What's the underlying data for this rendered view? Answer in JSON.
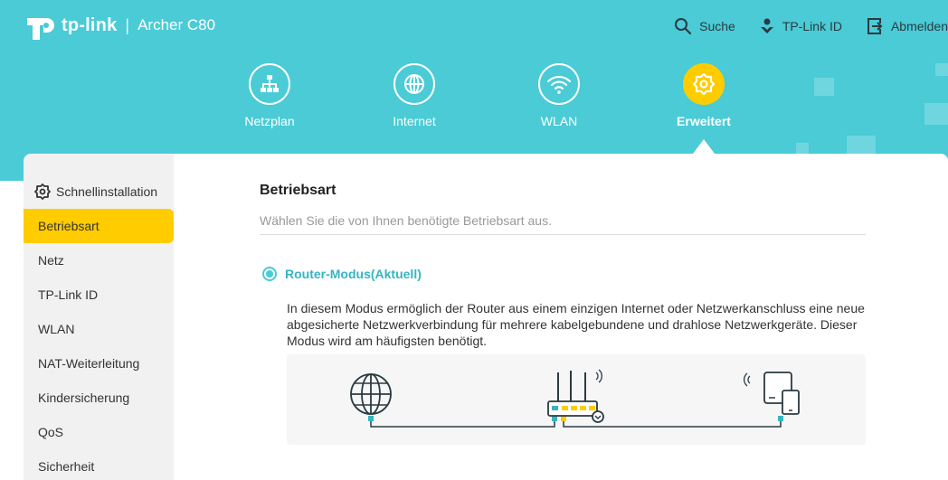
{
  "header": {
    "brand": "tp-link",
    "model": "Archer C80",
    "actions": [
      {
        "label": "Suche",
        "icon": "search-icon"
      },
      {
        "label": "TP-Link ID",
        "icon": "tplink-id-icon"
      },
      {
        "label": "Abmelden",
        "icon": "logout-icon"
      }
    ]
  },
  "nav": {
    "tabs": [
      {
        "label": "Netzplan",
        "icon": "network-map-icon",
        "active": false
      },
      {
        "label": "Internet",
        "icon": "globe-icon",
        "active": false
      },
      {
        "label": "WLAN",
        "icon": "wifi-icon",
        "active": false
      },
      {
        "label": "Erweitert",
        "icon": "gear-icon",
        "active": true
      }
    ]
  },
  "sidebar": {
    "items": [
      {
        "label": "Schnellinstallation",
        "icon": "gear-icon"
      },
      {
        "label": "Betriebsart",
        "active": true
      },
      {
        "label": "Netz"
      },
      {
        "label": "TP-Link ID"
      },
      {
        "label": "WLAN"
      },
      {
        "label": "NAT-Weiterleitung"
      },
      {
        "label": "Kindersicherung"
      },
      {
        "label": "QoS"
      },
      {
        "label": "Sicherheit"
      }
    ]
  },
  "main": {
    "title": "Betriebsart",
    "subtitle": "Wählen Sie die von Ihnen benötigte Betriebsart aus.",
    "mode_label": "Router-Modus(Aktuell)",
    "mode_selected": true,
    "mode_description": "In diesem Modus ermöglich der Router aus einem einzigen Internet oder Netzwerkanschluss eine neue abgesicherte Netzwerkverbindung für mehrere kabelgebundene und drahlose Netzwerkgeräte. Dieser Modus wird am häufigsten benötigt."
  },
  "colors": {
    "header_bg": "#4acbd6",
    "accent": "#ffcc00",
    "radio": "#4acbd6"
  }
}
